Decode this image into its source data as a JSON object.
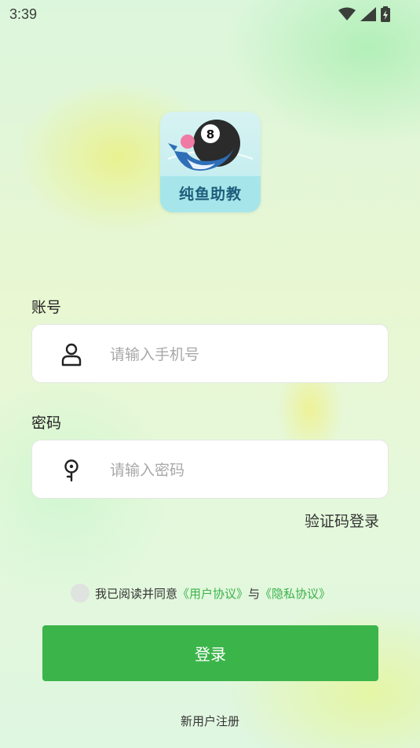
{
  "status_bar": {
    "time": "3:39"
  },
  "app": {
    "name": "纯鱼助教"
  },
  "form": {
    "account_label": "账号",
    "account_placeholder": "请输入手机号",
    "password_label": "密码",
    "password_placeholder": "请输入密码",
    "sms_login": "验证码登录"
  },
  "agreement": {
    "prefix": "我已阅读并同意",
    "user_agreement": "《用户协议》",
    "conjunction": "与",
    "privacy_policy": "《隐私协议》"
  },
  "login_button": "登录",
  "register_link": "新用户注册",
  "colors": {
    "accent": "#3bb54a",
    "link": "#3ab24a"
  }
}
